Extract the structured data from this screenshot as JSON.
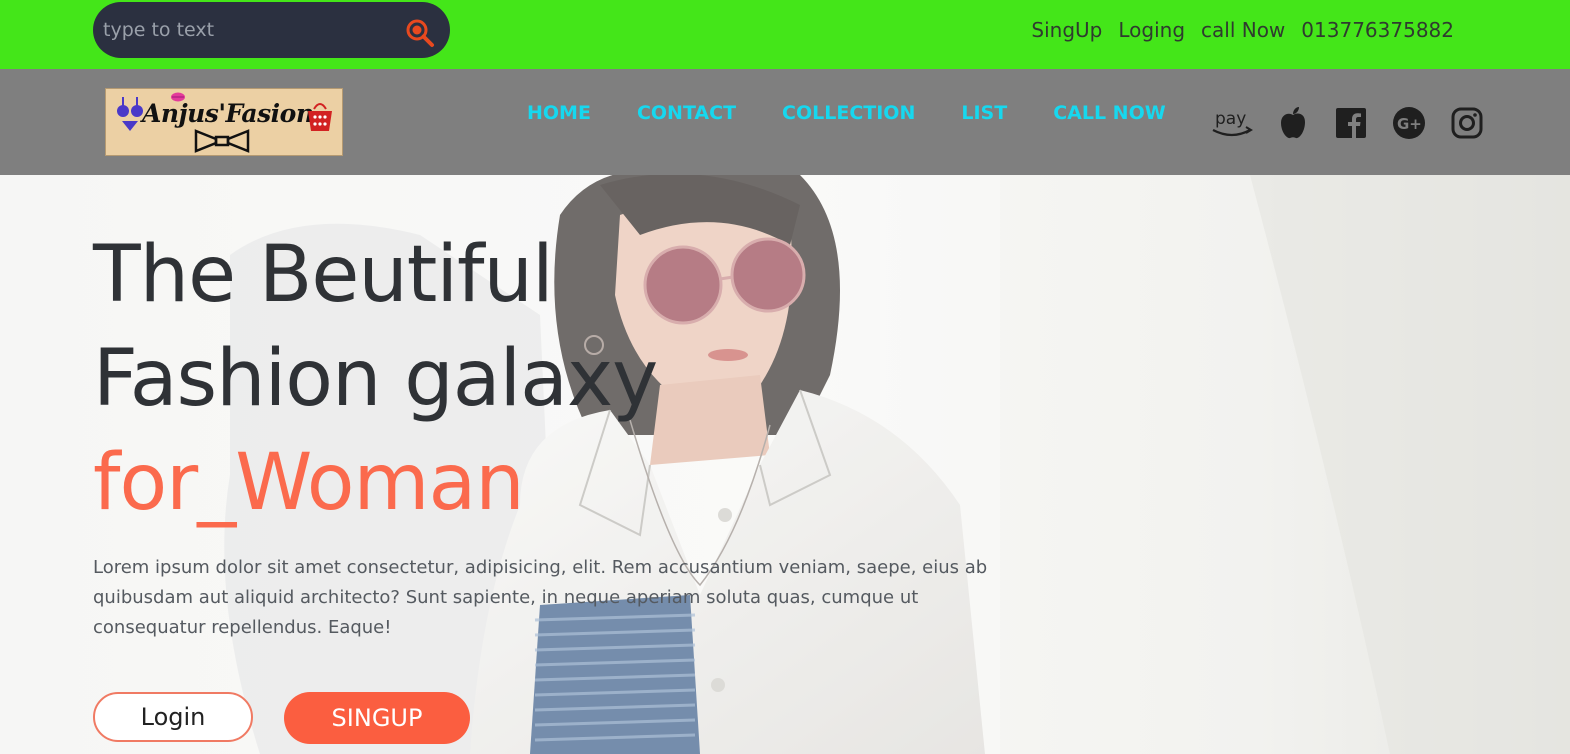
{
  "topbar": {
    "search": {
      "placeholder": "type to text"
    },
    "links": [
      "SingUp",
      "Loging",
      "call Now",
      "013776375882"
    ],
    "colors": {
      "background": "#44e619",
      "search_bg": "#2b3040",
      "search_icon": "#e8491f"
    }
  },
  "navbar": {
    "logo_text": "Anjus'Fasion",
    "items": [
      {
        "label": "HOME"
      },
      {
        "label": "CONTACT"
      },
      {
        "label": "COLLECTION"
      },
      {
        "label": "LIST"
      },
      {
        "label": "CALL NOW"
      }
    ],
    "social": [
      {
        "icon": "amazon-pay-icon",
        "text": "pay"
      },
      {
        "icon": "apple-icon"
      },
      {
        "icon": "facebook-icon"
      },
      {
        "icon": "google-plus-icon"
      },
      {
        "icon": "instagram-icon"
      }
    ],
    "colors": {
      "background": "#7f7f7f",
      "link": "#16d8ef"
    }
  },
  "hero": {
    "title_line1": "The Beutiful",
    "title_line2": "Fashion galaxy",
    "title_accent": "for_Woman",
    "paragraph": "Lorem ipsum dolor sit amet consectetur, adipisicing, elit. Rem accusantium veniam, saepe, eius ab quibusdam aut aliquid architecto? Sunt sapiente, in neque aperiam soluta quas, cumque ut consequatur repellendus. Eaque!",
    "login_label": "Login",
    "signup_label": "SINGUP",
    "colors": {
      "accent": "#fb6a4d",
      "title": "#2f3236"
    }
  }
}
